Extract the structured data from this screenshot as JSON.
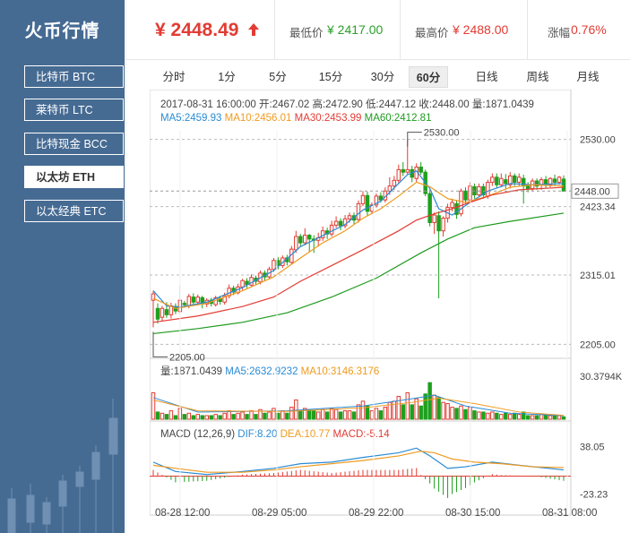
{
  "sidebar": {
    "title": "火币行情",
    "items": [
      {
        "label": "比特币 BTC",
        "active": false
      },
      {
        "label": "莱特币 LTC",
        "active": false
      },
      {
        "label": "比特现金 BCC",
        "active": false
      },
      {
        "label": "以太坊 ETH",
        "active": true
      },
      {
        "label": "以太经典 ETC",
        "active": false
      }
    ]
  },
  "quote": {
    "price": "¥ 2448.49",
    "low_label": "最低价",
    "low_value": "¥ 2417.00",
    "high_label": "最高价",
    "high_value": "¥ 2488.00",
    "change_label": "涨幅",
    "change_value": "0.76%"
  },
  "tabs": [
    {
      "label": "分时",
      "active": false
    },
    {
      "label": "1分",
      "active": false
    },
    {
      "label": "5分",
      "active": false
    },
    {
      "label": "15分",
      "active": false
    },
    {
      "label": "30分",
      "active": false
    },
    {
      "label": "60分",
      "active": true
    },
    {
      "label": "日线",
      "active": false
    },
    {
      "label": "周线",
      "active": false
    },
    {
      "label": "月线",
      "active": false
    }
  ],
  "colors": {
    "up": "#e23b33",
    "down": "#1ea01e",
    "ma5": "#2a8bd4",
    "ma10": "#f09a1e",
    "ma30": "#e23b33",
    "ma60": "#1e9a1e",
    "sidebar": "#466b93"
  },
  "chart_data": {
    "type": "candlestick",
    "info": {
      "time": "2017-08-31 16:00:00",
      "open": "开:2467.02",
      "high": "高:2472.90",
      "low": "低:2447.12",
      "close": "收:2448.00",
      "volume": "量:1871.0439",
      "ma5": "MA5:2459.93",
      "ma10": "MA10:2456.01",
      "ma30": "MA30:2453.99",
      "ma60": "MA60:2412.81"
    },
    "y_ticks": [
      "2530.00",
      "2423.34",
      "2315.01",
      "2205.00"
    ],
    "y_range": [
      2190,
      2545
    ],
    "current_price": "2448.00",
    "max_marker": "2530.00",
    "min_marker": "2205.00",
    "x_ticks": [
      "08-28 12:00",
      "08-29 05:00",
      "08-29 22:00",
      "08-30 15:00",
      "08-31 08:00"
    ],
    "candles": [
      [
        2275,
        2285,
        2232,
        2290
      ],
      [
        2262,
        2245,
        2238,
        2270
      ],
      [
        2248,
        2262,
        2242,
        2266
      ],
      [
        2260,
        2252,
        2247,
        2272
      ],
      [
        2252,
        2266,
        2246,
        2271
      ],
      [
        2265,
        2258,
        2253,
        2270
      ],
      [
        2257,
        2275,
        2252,
        2299
      ],
      [
        2270,
        2268,
        2263,
        2274
      ],
      [
        2266,
        2281,
        2262,
        2285
      ],
      [
        2280,
        2272,
        2266,
        2286
      ],
      [
        2272,
        2280,
        2268,
        2284
      ],
      [
        2279,
        2270,
        2262,
        2282
      ],
      [
        2269,
        2275,
        2264,
        2278
      ],
      [
        2275,
        2270,
        2265,
        2279
      ],
      [
        2268,
        2279,
        2265,
        2282
      ],
      [
        2278,
        2273,
        2268,
        2282
      ],
      [
        2272,
        2282,
        2268,
        2287
      ],
      [
        2282,
        2294,
        2278,
        2300
      ],
      [
        2294,
        2288,
        2283,
        2298
      ],
      [
        2287,
        2296,
        2284,
        2301
      ],
      [
        2296,
        2306,
        2291,
        2309
      ],
      [
        2305,
        2300,
        2294,
        2310
      ],
      [
        2299,
        2311,
        2297,
        2316
      ],
      [
        2310,
        2305,
        2300,
        2314
      ],
      [
        2304,
        2318,
        2300,
        2322
      ],
      [
        2318,
        2312,
        2306,
        2322
      ],
      [
        2312,
        2324,
        2308,
        2328
      ],
      [
        2324,
        2338,
        2320,
        2342
      ],
      [
        2338,
        2330,
        2324,
        2343
      ],
      [
        2330,
        2342,
        2326,
        2346
      ],
      [
        2342,
        2336,
        2330,
        2347
      ],
      [
        2335,
        2356,
        2332,
        2361
      ],
      [
        2355,
        2376,
        2350,
        2385
      ],
      [
        2376,
        2366,
        2360,
        2380
      ],
      [
        2366,
        2378,
        2362,
        2389
      ],
      [
        2378,
        2372,
        2352,
        2380
      ],
      [
        2372,
        2370,
        2350,
        2378
      ],
      [
        2370,
        2374,
        2360,
        2382
      ],
      [
        2374,
        2385,
        2369,
        2392
      ],
      [
        2385,
        2380,
        2372,
        2390
      ],
      [
        2380,
        2394,
        2376,
        2401
      ],
      [
        2394,
        2400,
        2390,
        2408
      ],
      [
        2400,
        2393,
        2386,
        2405
      ],
      [
        2393,
        2404,
        2389,
        2410
      ],
      [
        2404,
        2409,
        2398,
        2414
      ],
      [
        2409,
        2402,
        2395,
        2414
      ],
      [
        2403,
        2428,
        2398,
        2433
      ],
      [
        2428,
        2441,
        2424,
        2448
      ],
      [
        2441,
        2416,
        2408,
        2447
      ],
      [
        2416,
        2426,
        2412,
        2430
      ],
      [
        2426,
        2440,
        2422,
        2444
      ],
      [
        2440,
        2434,
        2430,
        2446
      ],
      [
        2434,
        2448,
        2430,
        2454
      ],
      [
        2448,
        2456,
        2442,
        2470
      ],
      [
        2456,
        2465,
        2450,
        2472
      ],
      [
        2465,
        2482,
        2460,
        2490
      ],
      [
        2482,
        2478,
        2472,
        2494
      ],
      [
        2478,
        2482,
        2474,
        2530
      ],
      [
        2482,
        2470,
        2462,
        2488
      ],
      [
        2468,
        2486,
        2462,
        2492
      ],
      [
        2486,
        2478,
        2474,
        2494
      ],
      [
        2478,
        2444,
        2440,
        2482
      ],
      [
        2444,
        2398,
        2392,
        2450
      ],
      [
        2398,
        2410,
        2380,
        2414
      ],
      [
        2409,
        2385,
        2278,
        2416
      ],
      [
        2385,
        2405,
        2376,
        2408
      ],
      [
        2405,
        2422,
        2398,
        2428
      ],
      [
        2422,
        2430,
        2416,
        2436
      ],
      [
        2428,
        2411,
        2404,
        2434
      ],
      [
        2412,
        2448,
        2408,
        2452
      ],
      [
        2448,
        2434,
        2428,
        2454
      ],
      [
        2434,
        2456,
        2430,
        2462
      ],
      [
        2455,
        2442,
        2436,
        2460
      ],
      [
        2442,
        2455,
        2438,
        2460
      ],
      [
        2455,
        2442,
        2436,
        2460
      ],
      [
        2440,
        2462,
        2436,
        2466
      ],
      [
        2462,
        2470,
        2456,
        2476
      ],
      [
        2470,
        2458,
        2452,
        2476
      ],
      [
        2458,
        2468,
        2454,
        2476
      ],
      [
        2466,
        2460,
        2452,
        2475
      ],
      [
        2458,
        2472,
        2452,
        2478
      ],
      [
        2472,
        2462,
        2456,
        2476
      ],
      [
        2462,
        2470,
        2456,
        2476
      ],
      [
        2468,
        2456,
        2428,
        2474
      ],
      [
        2456,
        2452,
        2446,
        2462
      ],
      [
        2452,
        2464,
        2448,
        2468
      ],
      [
        2464,
        2456,
        2450,
        2468
      ],
      [
        2458,
        2466,
        2450,
        2470
      ],
      [
        2466,
        2458,
        2452,
        2472
      ],
      [
        2458,
        2468,
        2454,
        2470
      ],
      [
        2467,
        2462,
        2456,
        2474
      ],
      [
        2462,
        2470,
        2458,
        2472
      ],
      [
        2467,
        2448,
        2447,
        2473
      ]
    ],
    "ma_lines": {
      "MA5": [
        [
          0,
          2290
        ],
        [
          3,
          2266
        ],
        [
          6,
          2264
        ],
        [
          12,
          2272
        ],
        [
          20,
          2295
        ],
        [
          27,
          2322
        ],
        [
          33,
          2360
        ],
        [
          37,
          2374
        ],
        [
          43,
          2395
        ],
        [
          47,
          2418
        ],
        [
          51,
          2432
        ],
        [
          55,
          2460
        ],
        [
          57,
          2474
        ],
        [
          59,
          2480
        ],
        [
          62,
          2452
        ],
        [
          64,
          2420
        ],
        [
          67,
          2410
        ],
        [
          71,
          2430
        ],
        [
          75,
          2448
        ],
        [
          80,
          2460
        ],
        [
          85,
          2458
        ],
        [
          92,
          2460
        ]
      ],
      "MA10": [
        [
          0,
          2278
        ],
        [
          5,
          2262
        ],
        [
          12,
          2270
        ],
        [
          20,
          2290
        ],
        [
          27,
          2312
        ],
        [
          33,
          2342
        ],
        [
          38,
          2366
        ],
        [
          43,
          2385
        ],
        [
          47,
          2405
        ],
        [
          51,
          2420
        ],
        [
          55,
          2440
        ],
        [
          59,
          2462
        ],
        [
          62,
          2455
        ],
        [
          66,
          2436
        ],
        [
          70,
          2430
        ],
        [
          75,
          2440
        ],
        [
          80,
          2454
        ],
        [
          85,
          2458
        ],
        [
          92,
          2456
        ]
      ],
      "MA30": [
        [
          0,
          2240
        ],
        [
          10,
          2250
        ],
        [
          20,
          2265
        ],
        [
          27,
          2280
        ],
        [
          33,
          2305
        ],
        [
          40,
          2330
        ],
        [
          47,
          2355
        ],
        [
          55,
          2385
        ],
        [
          59,
          2402
        ],
        [
          63,
          2412
        ],
        [
          67,
          2420
        ],
        [
          71,
          2430
        ],
        [
          76,
          2442
        ],
        [
          82,
          2450
        ],
        [
          92,
          2454
        ]
      ],
      "MA60": [
        [
          0,
          2222
        ],
        [
          10,
          2230
        ],
        [
          20,
          2240
        ],
        [
          30,
          2255
        ],
        [
          40,
          2280
        ],
        [
          50,
          2310
        ],
        [
          60,
          2350
        ],
        [
          66,
          2372
        ],
        [
          72,
          2390
        ],
        [
          80,
          2400
        ],
        [
          92,
          2413
        ]
      ]
    },
    "volume": {
      "title": "量:1871.0439",
      "ma5": "MA5:2632.9232",
      "ma10": "MA10:3146.3176",
      "y_tick": "30.3794K",
      "y_max": 32000,
      "values": [
        22000,
        6000,
        5000,
        4000,
        7000,
        3000,
        9000,
        4000,
        5000,
        3000,
        4000,
        3000,
        3000,
        3000,
        4000,
        3000,
        5000,
        7000,
        4000,
        5000,
        6000,
        4000,
        7000,
        4000,
        8000,
        5000,
        6000,
        9000,
        5000,
        7000,
        5000,
        10000,
        16000,
        7000,
        9000,
        8000,
        7000,
        6000,
        8000,
        6000,
        9000,
        8000,
        6000,
        7000,
        7000,
        6000,
        12000,
        15000,
        11000,
        7000,
        9000,
        7000,
        10000,
        14000,
        15000,
        19000,
        12000,
        22000,
        12000,
        17000,
        11000,
        21000,
        30379,
        20000,
        18000,
        14000,
        13000,
        10000,
        9000,
        11000,
        8000,
        10000,
        7000,
        6000,
        6000,
        5000,
        6000,
        5000,
        4000,
        5000,
        4000,
        5000,
        4000,
        6000,
        3000,
        3000,
        3000,
        4000,
        3000,
        3000,
        3000,
        3000,
        2000
      ],
      "ma5_line": [
        [
          0,
          18000
        ],
        [
          10,
          6000
        ],
        [
          30,
          7000
        ],
        [
          47,
          11000
        ],
        [
          58,
          17000
        ],
        [
          63,
          20000
        ],
        [
          70,
          11000
        ],
        [
          80,
          5000
        ],
        [
          92,
          3000
        ]
      ],
      "ma10_line": [
        [
          0,
          16000
        ],
        [
          10,
          7000
        ],
        [
          30,
          6500
        ],
        [
          47,
          9500
        ],
        [
          58,
          14000
        ],
        [
          64,
          17500
        ],
        [
          72,
          13000
        ],
        [
          82,
          6000
        ],
        [
          92,
          3300
        ]
      ]
    },
    "macd": {
      "title": "MACD (12,26,9)",
      "dif": "DIF:8.20",
      "dea": "DEA:10.77",
      "macd": "MACD:-5.14",
      "y_ticks": [
        "38.05",
        "-23.23"
      ],
      "y_range": [
        -27,
        42
      ],
      "dif_line": [
        [
          0,
          18
        ],
        [
          5,
          6
        ],
        [
          12,
          2
        ],
        [
          20,
          6
        ],
        [
          27,
          10
        ],
        [
          33,
          16
        ],
        [
          40,
          18
        ],
        [
          47,
          24
        ],
        [
          55,
          30
        ],
        [
          59,
          36
        ],
        [
          62,
          26
        ],
        [
          66,
          10
        ],
        [
          70,
          12
        ],
        [
          76,
          18
        ],
        [
          82,
          14
        ],
        [
          92,
          8
        ]
      ],
      "dea_line": [
        [
          0,
          14
        ],
        [
          5,
          10
        ],
        [
          12,
          5
        ],
        [
          20,
          5
        ],
        [
          27,
          8
        ],
        [
          33,
          12
        ],
        [
          40,
          16
        ],
        [
          47,
          20
        ],
        [
          55,
          26
        ],
        [
          60,
          32
        ],
        [
          63,
          30
        ],
        [
          67,
          22
        ],
        [
          72,
          18
        ],
        [
          78,
          16
        ],
        [
          85,
          12
        ],
        [
          92,
          11
        ]
      ]
    }
  }
}
